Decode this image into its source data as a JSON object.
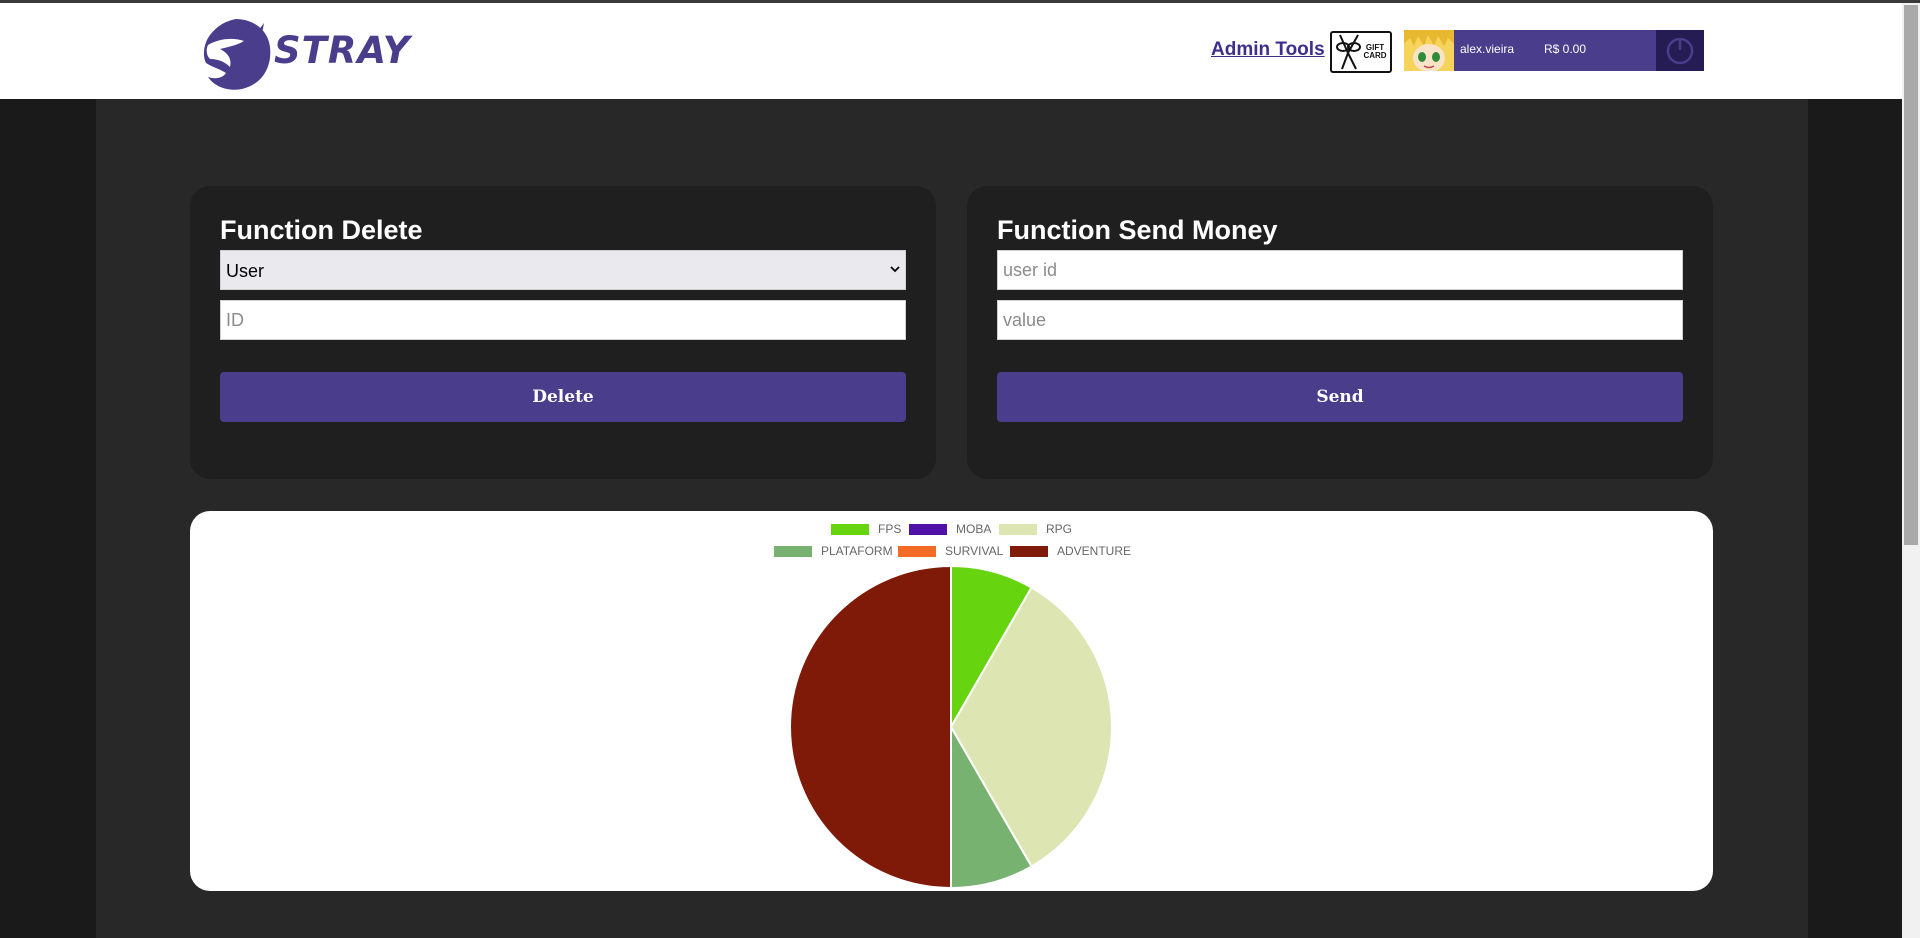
{
  "header": {
    "brand": "STRAY",
    "admin_link": "Admin Tools",
    "gift_card": "GIFT CARD",
    "user": {
      "name": "alex.vieira",
      "balance": "R$ 0.00"
    }
  },
  "delete_panel": {
    "title": "Function Delete",
    "select_value": "User",
    "id_placeholder": "ID",
    "button": "Delete"
  },
  "send_panel": {
    "title": "Function Send Money",
    "user_placeholder": "user id",
    "value_placeholder": "value",
    "button": "Send"
  },
  "chart_data": {
    "type": "pie",
    "categories": [
      "FPS",
      "MOBA",
      "RPG",
      "PLATAFORM",
      "SURVIVAL",
      "ADVENTURE"
    ],
    "values": [
      1,
      0,
      4,
      1,
      0,
      6
    ],
    "colors": [
      "#66d40f",
      "#5012a6",
      "#dde5b3",
      "#77b270",
      "#f26c27",
      "#801a08"
    ],
    "legend_position": "top"
  },
  "colors": {
    "accent": "#4a3d8c",
    "page_bg": "#282828",
    "card_bg": "#1f1f1f"
  }
}
